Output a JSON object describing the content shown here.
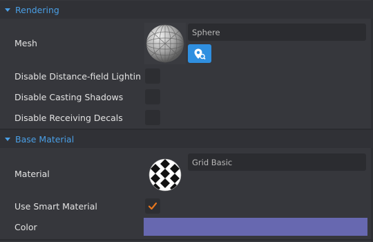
{
  "rendering": {
    "title": "Rendering",
    "mesh_label": "Mesh",
    "mesh_value": "Sphere",
    "mesh_icon": "sphere-wireframe-thumbnail",
    "locate_icon": "locate-asset-icon",
    "disable_distance_field_label": "Disable Distance-field Lightin",
    "disable_casting_shadows_label": "Disable Casting Shadows",
    "disable_receiving_decals_label": "Disable Receiving Decals",
    "disable_distance_field_checked": false,
    "disable_casting_shadows_checked": false,
    "disable_receiving_decals_checked": false
  },
  "base_material": {
    "title": "Base Material",
    "material_label": "Material",
    "material_value": "Grid Basic",
    "material_icon": "checker-sphere-thumbnail",
    "use_smart_material_label": "Use Smart Material",
    "use_smart_material_checked": true,
    "color_label": "Color",
    "color_value": "#6768b0"
  },
  "colors": {
    "accent": "#4a9fe6",
    "panel_bg": "#36373c",
    "checkmark": "#e8771e",
    "button": "#2f8fe0"
  }
}
